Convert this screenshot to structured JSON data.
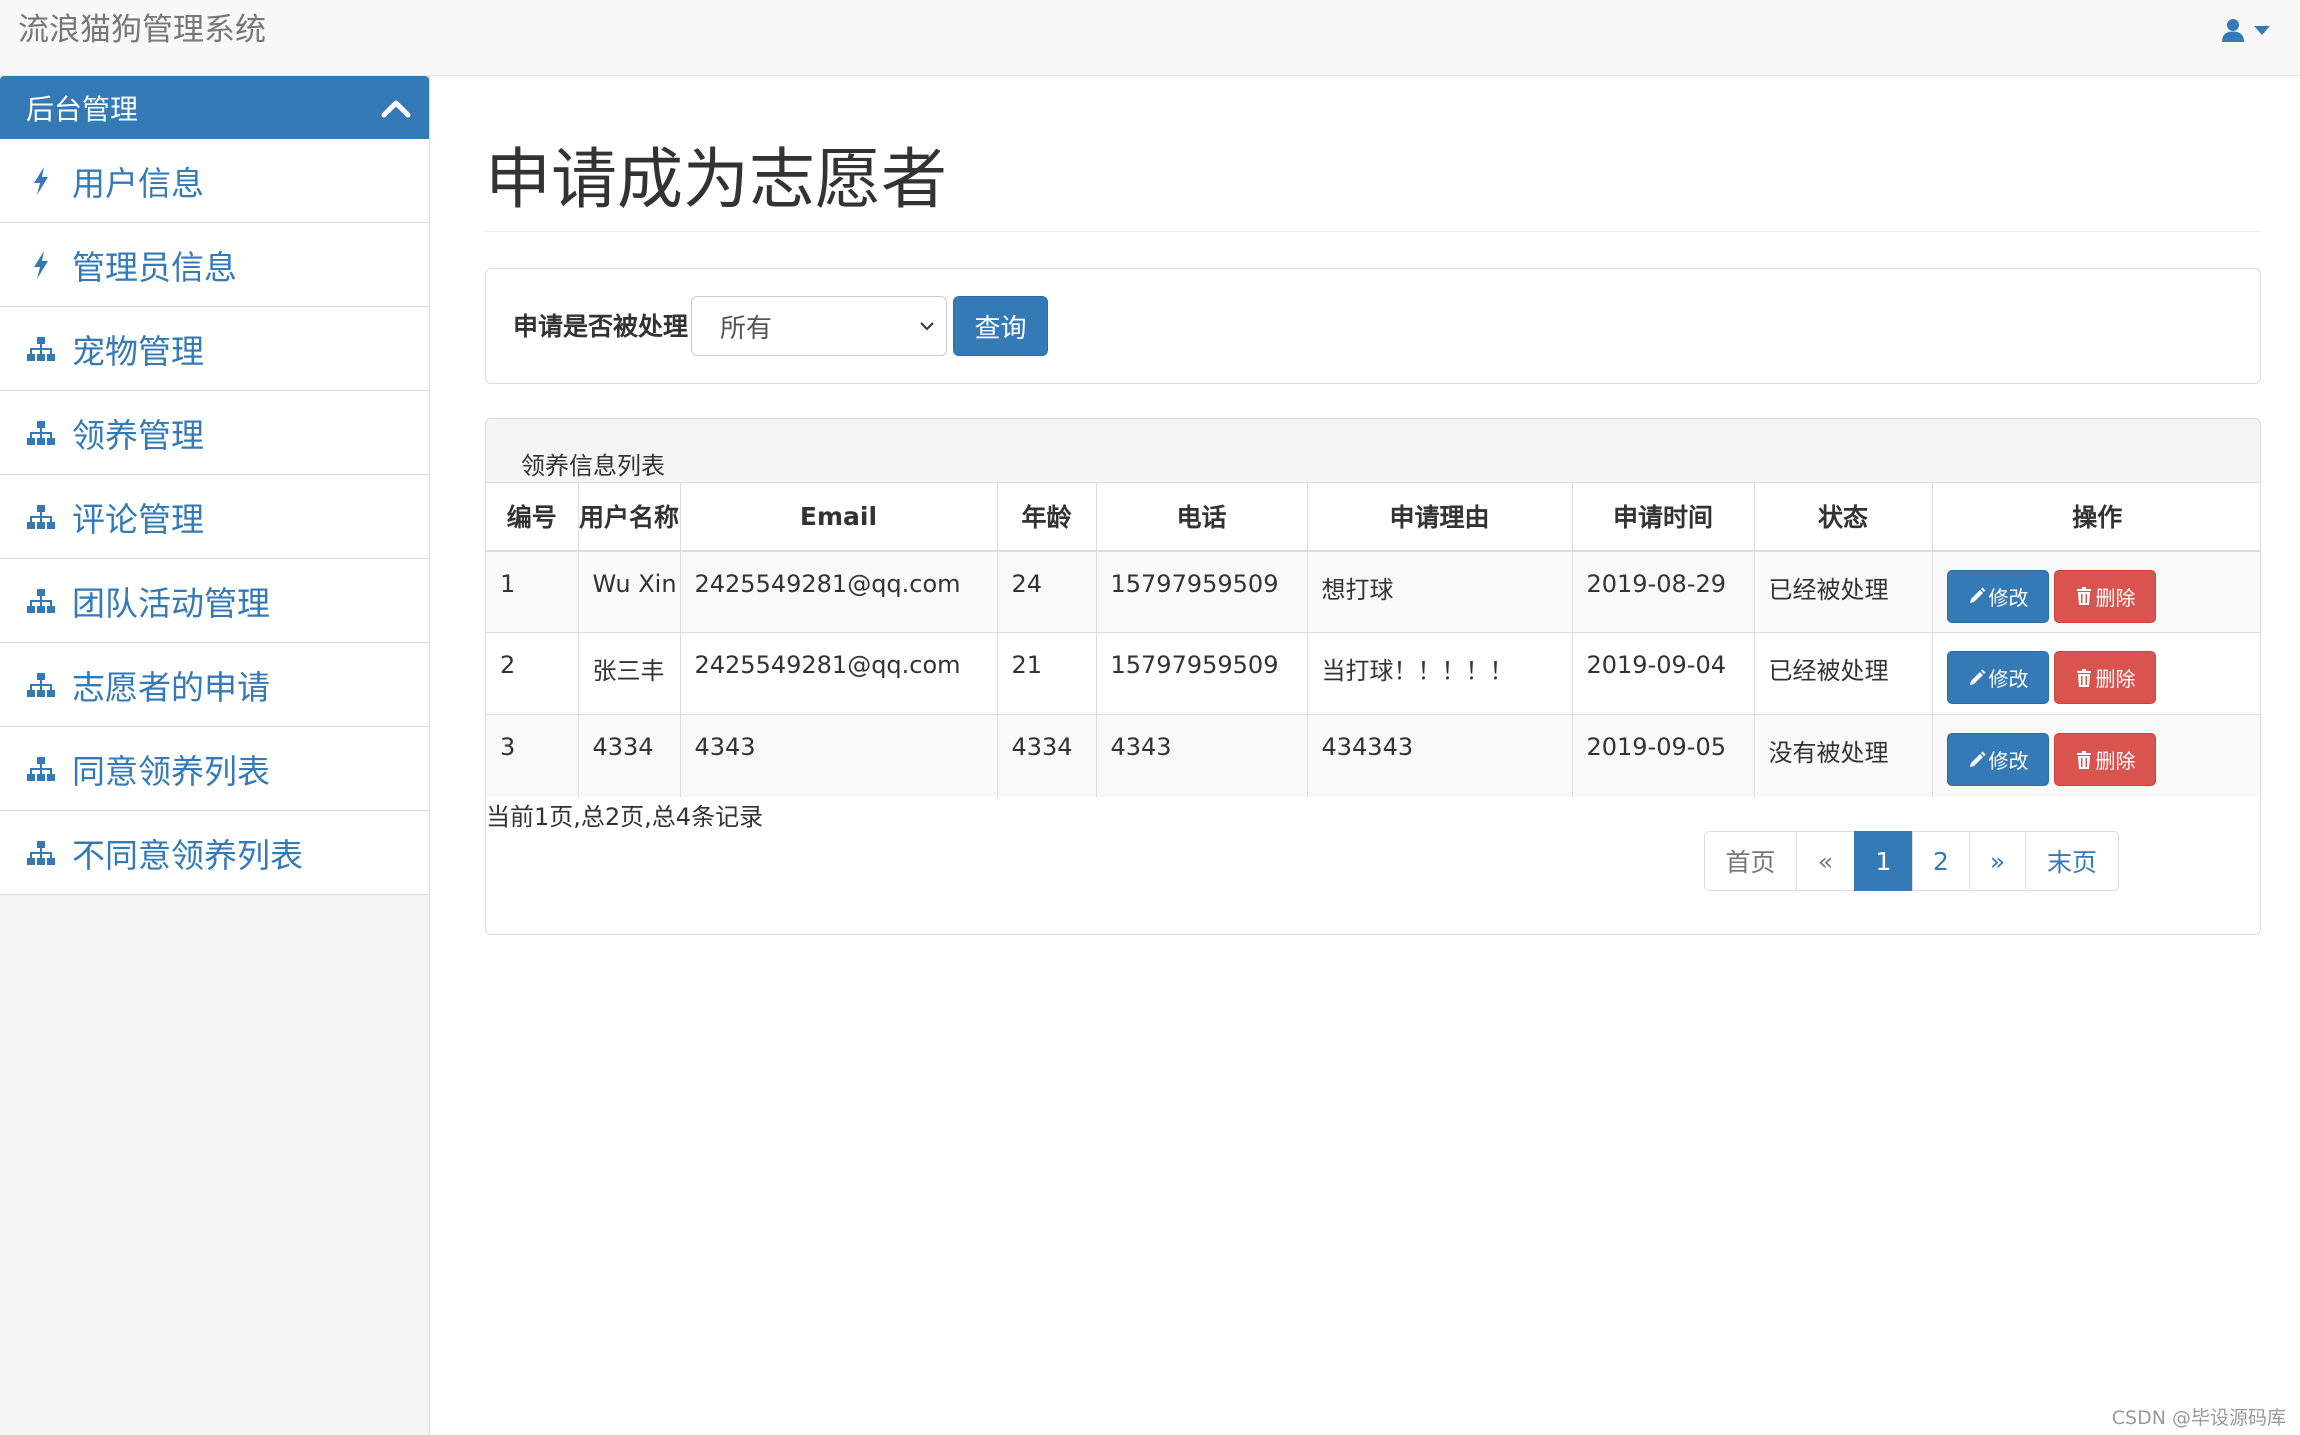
{
  "navbar": {
    "brand": "流浪猫狗管理系统",
    "user_icon": "user-icon",
    "accent": "#337ab7"
  },
  "sidebar": {
    "header": "后台管理",
    "items": [
      {
        "label": "用户信息",
        "icon": "bolt-icon"
      },
      {
        "label": "管理员信息",
        "icon": "bolt-icon"
      },
      {
        "label": "宠物管理",
        "icon": "sitemap-icon"
      },
      {
        "label": "领养管理",
        "icon": "sitemap-icon"
      },
      {
        "label": "评论管理",
        "icon": "sitemap-icon"
      },
      {
        "label": "团队活动管理",
        "icon": "sitemap-icon"
      },
      {
        "label": "志愿者的申请",
        "icon": "sitemap-icon"
      },
      {
        "label": "同意领养列表",
        "icon": "sitemap-icon"
      },
      {
        "label": "不同意领养列表",
        "icon": "sitemap-icon"
      }
    ]
  },
  "main": {
    "title": "申请成为志愿者",
    "filter": {
      "label": "申请是否被处理",
      "selected": "所有",
      "query_button": "查询"
    },
    "list": {
      "heading": "领养信息列表",
      "columns": [
        "编号",
        "用户名称",
        "Email",
        "年龄",
        "电话",
        "申请理由",
        "申请时间",
        "状态",
        "操作"
      ],
      "rows": [
        [
          "1",
          "Wu Xin",
          "2425549281@qq.com",
          "24",
          "15797959509",
          "想打球",
          "2019-08-29",
          "已经被处理"
        ],
        [
          "2",
          "张三丰",
          "2425549281@qq.com",
          "21",
          "15797959509",
          "当打球！！！！！",
          "2019-09-04",
          "已经被处理"
        ],
        [
          "3",
          "4334",
          "4343",
          "4334",
          "4343",
          "434343",
          "2019-09-05",
          "没有被处理"
        ]
      ],
      "edit_label": "修改",
      "delete_label": "删除"
    },
    "page_info": "当前1页,总2页,总4条记录",
    "pagination": {
      "first": "首页",
      "prev": "«",
      "pages": [
        "1",
        "2"
      ],
      "current": "1",
      "next": "»",
      "last": "末页"
    }
  },
  "watermark": "CSDN @毕设源码库"
}
